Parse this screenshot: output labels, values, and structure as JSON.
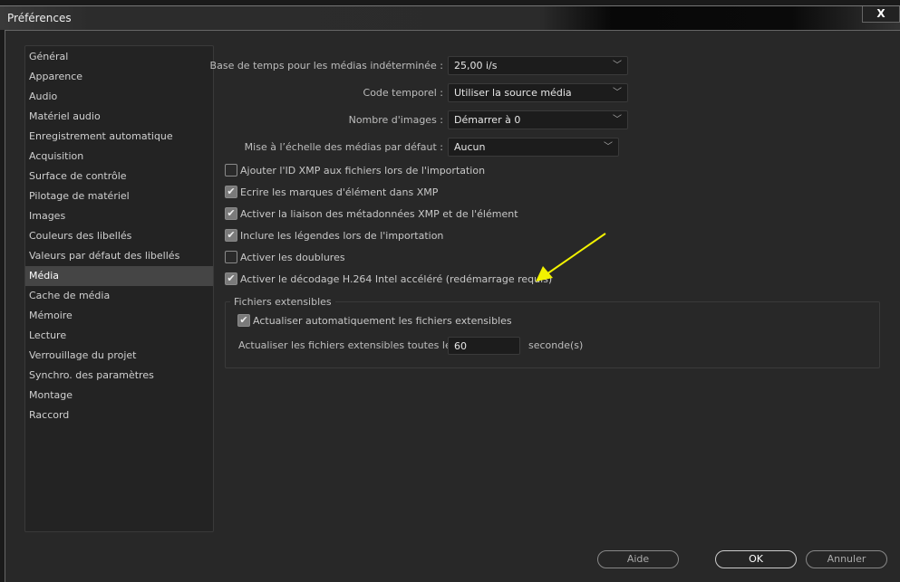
{
  "window": {
    "title": "Préférences",
    "close": "X"
  },
  "sidebar": {
    "items": [
      "Général",
      "Apparence",
      "Audio",
      "Matériel audio",
      "Enregistrement automatique",
      "Acquisition",
      "Surface de contrôle",
      "Pilotage de matériel",
      "Images",
      "Couleurs des libellés",
      "Valeurs par défaut des libellés",
      "Média",
      "Cache de média",
      "Mémoire",
      "Lecture",
      "Verrouillage du projet",
      "Synchro. des paramètres",
      "Montage",
      "Raccord"
    ],
    "selected": "Média"
  },
  "fields": [
    {
      "label": "Base de temps pour les médias indéterminée :",
      "value": "25,00  i/s"
    },
    {
      "label": "Code temporel :",
      "value": "Utiliser la source média"
    },
    {
      "label": "Nombre d'images :",
      "value": "Démarrer à 0"
    },
    {
      "label": "Mise à l’échelle des médias par défaut :",
      "value": "Aucun"
    }
  ],
  "checkboxes": [
    {
      "label": "Ajouter l'ID XMP aux fichiers lors de l'importation",
      "checked": false
    },
    {
      "label": "Ecrire les marques d'élément dans XMP",
      "checked": true
    },
    {
      "label": "Activer la liaison des métadonnées XMP et de l'élément",
      "checked": true
    },
    {
      "label": "Inclure les légendes lors de l'importation",
      "checked": true
    },
    {
      "label": "Activer les doublures",
      "checked": false
    },
    {
      "label": "Activer le décodage H.264 Intel accéléré (redémarrage requis)",
      "checked": true
    }
  ],
  "group": {
    "title": "Fichiers extensibles",
    "auto_label": "Actualiser automatiquement les fichiers extensibles",
    "auto_checked": true,
    "interval_label": "Actualiser les fichiers extensibles toutes les",
    "interval_value": "60",
    "interval_unit": "seconde(s)"
  },
  "buttons": {
    "help": "Aide",
    "ok": "OK",
    "cancel": "Annuler"
  },
  "colors": {
    "arrow": "#f2f200",
    "selected": "#454545"
  }
}
